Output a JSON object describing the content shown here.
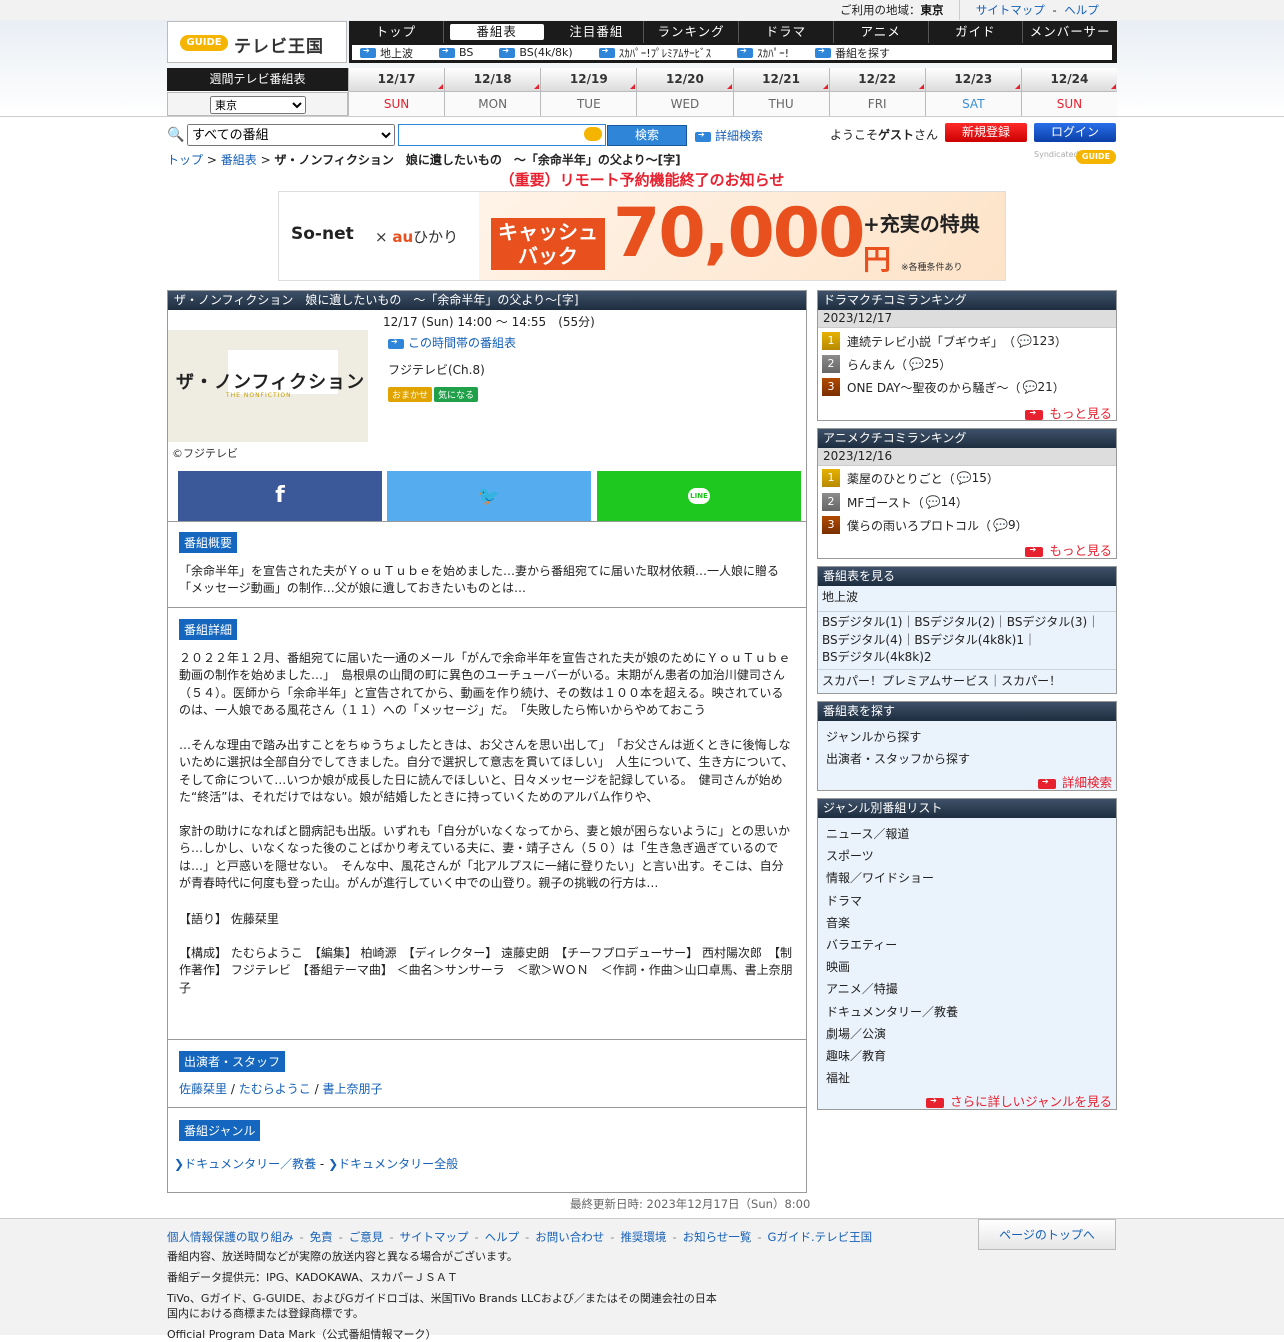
{
  "topbar": {
    "area_label": "ご利用の地域：",
    "area_value": "東京",
    "sitemap": "サイトマップ",
    "dash": "-",
    "help": "ヘルプ"
  },
  "logo": {
    "g": "GUIDE",
    "text": "テレビ王国"
  },
  "nav": [
    "トップ",
    "番組表",
    "注目番組",
    "ランキング",
    "ドラマ",
    "アニメ",
    "ガイド",
    "メンバーサービス"
  ],
  "subnav": [
    "地上波",
    "BS",
    "BS(4k/8k)",
    "ｽｶﾊﾟｰ!ﾌﾟﾚﾐｱﾑｻｰﾋﾞｽ",
    "ｽｶﾊﾟｰ!",
    "番組を探す"
  ],
  "week": {
    "label": "週間テレビ番組表",
    "area": "東京",
    "days": [
      {
        "date": "12/17",
        "wday": "SUN",
        "type": "sun"
      },
      {
        "date": "12/18",
        "wday": "MON",
        "type": "wd"
      },
      {
        "date": "12/19",
        "wday": "TUE",
        "type": "wd"
      },
      {
        "date": "12/20",
        "wday": "WED",
        "type": "wd"
      },
      {
        "date": "12/21",
        "wday": "THU",
        "type": "wd"
      },
      {
        "date": "12/22",
        "wday": "FRI",
        "type": "wd"
      },
      {
        "date": "12/23",
        "wday": "SAT",
        "type": "sat"
      },
      {
        "date": "12/24",
        "wday": "SUN",
        "type": "sun"
      }
    ]
  },
  "search": {
    "select": "すべての番組",
    "button": "検索",
    "advanced": "詳細検索"
  },
  "user": {
    "welcome_pre": "ようこそ",
    "guest": "ゲスト",
    "welcome_post": "さん",
    "signup": "新規登録",
    "login": "ログイン"
  },
  "breadcrumb": {
    "top": "トップ",
    "sep": ">",
    "schedule": "番組表",
    "current": "ザ・ノンフィクション　娘に遺したいもの　～「余命半年」の父より～[字]"
  },
  "syndicated": "Syndicated",
  "notice": "（重要）リモート予約機能終了のお知らせ",
  "banner": {
    "sonet": "So-net",
    "x": "×",
    "au": "au",
    "hikari": "ひかり",
    "cash1": "キャッシュ",
    "cash2": "バック",
    "amount": "70,000",
    "yen": "円",
    "plus": "+充実の特典",
    "cond": "※各種条件あり"
  },
  "program": {
    "title": "ザ・ノンフィクション　娘に遺したいもの　～「余命半年」の父より～[字]",
    "time": "12/17 (Sun) 14:00 ～ 14:55　(55分)",
    "time_link": "この時間帯の番組表",
    "channel": "フジテレビ(Ch.8)",
    "badges": [
      "おまかせ",
      "気になる"
    ],
    "thumb_title": "ザ・ノンフィクション",
    "thumb_sub": "THE NONFICTION",
    "copyright": "©フジテレビ",
    "share": {
      "facebook": "f",
      "twitter": "🐦",
      "line": "LINE"
    },
    "summary_head": "番組概要",
    "summary": "「余命半年」を宣告された夫がＹｏｕＴｕｂｅを始めました…妻から番組宛てに届いた取材依頼…一人娘に贈る「メッセージ動画」の制作…父が娘に遺しておきたいものとは…",
    "detail_head": "番組詳細",
    "detail_p1": "２０２２年１２月、番組宛てに届いた一通のメール「がんで余命半年を宣告された夫が娘のためにＹｏｕＴｕｂｅ動画の制作を始めました…」　島根県の山間の町に異色のユーチューバーがいる。末期がん患者の加治川健司さん（５４）。医師から「余命半年」と宣告されてから、動画を作り続け、その数は１００本を超える。映されているのは、一人娘である風花さん（１１）への「メッセージ」だ。　「失敗したら怖いからやめておこう",
    "detail_p2": "…そんな理由で踏み出すことをちゅうちょしたときは、お父さんを思い出して」　「お父さんは逝くときに後悔しないために選択は全部自分でしてきました。自分で選択して意志を貫いてほしい」　人生について、生き方について、そして命について…いつか娘が成長した日に読んでほしいと、日々メッセージを記録している。　健司さんが始めた“終活”は、それだけではない。娘が結婚したときに持っていくためのアルバム作りや、",
    "detail_p3": "家計の助けになればと闘病記も出版。いずれも「自分がいなくなってから、妻と娘が困らないように」との思いから…しかし、いなくなった後のことばかり考えている夫に、妻・靖子さん（５０）は「生き急ぎ過ぎているのでは…」と戸惑いを隠せない。　そんな中、風花さんが「北アルプスに一緒に登りたい」と言い出す。そこは、自分が青春時代に何度も登った山。がんが進行していく中での山登り。親子の挑戦の行方は…",
    "detail_p4": "【語り】 佐藤栞里",
    "detail_p5": "【構成】 たむらようこ　【編集】 柏崎源　【ディレクター】 遠藤史朗　【チーフプロデューサー】 西村陽次郎　【制作著作】 フジテレビ　【番組テーマ曲】 ＜曲名＞サンサーラ　＜歌＞ＷＯＮ　＜作詞・作曲＞山口卓馬、書上奈朋子",
    "cast_head": "出演者・スタッフ",
    "cast": [
      "佐藤栞里",
      "たむらようこ",
      "書上奈朋子"
    ],
    "cast_sep": "/",
    "genre_head": "番組ジャンル",
    "genres": [
      "ドキュメンタリー／教養",
      "ドキュメンタリー全般"
    ],
    "genre_sep": "-",
    "updated": "最終更新日時: 2023年12月17日（Sun）8:00"
  },
  "drama_rank": {
    "title": "ドラマクチコミランキング",
    "date": "2023/12/17",
    "items": [
      {
        "rank": "1",
        "title": "連続テレビ小説「ブギウギ」",
        "count": "123"
      },
      {
        "rank": "2",
        "title": "らんまん",
        "count": "25"
      },
      {
        "rank": "3",
        "title": "ONE DAY～聖夜のから騒ぎ～",
        "count": "21"
      }
    ],
    "more": "もっと見る"
  },
  "anime_rank": {
    "title": "アニメクチコミランキング",
    "date": "2023/12/16",
    "items": [
      {
        "rank": "1",
        "title": "薬屋のひとりごと",
        "count": "15"
      },
      {
        "rank": "2",
        "title": "MFゴースト",
        "count": "14"
      },
      {
        "rank": "3",
        "title": "僕らの雨いろプロトコル",
        "count": "9"
      }
    ],
    "more": "もっと見る"
  },
  "schedule_box": {
    "title": "番組表を見る",
    "terrestrial": "地上波",
    "bs_line1": "BSデジタル(1)｜BSデジタル(2)｜BSデジタル(3)｜",
    "bs_line2": "BSデジタル(4)｜BSデジタル(4k8k)1｜",
    "bs_line3": "BSデジタル(4k8k)2",
    "sky": "スカパー！プレミアムサービス｜スカパー！"
  },
  "find_box": {
    "title": "番組表を探す",
    "genre": "ジャンルから探す",
    "cast": "出演者・スタッフから探す",
    "adv": "詳細検索"
  },
  "genre_box": {
    "title": "ジャンル別番組リスト",
    "items": [
      "ニュース／報道",
      "スポーツ",
      "情報／ワイドショー",
      "ドラマ",
      "音楽",
      "バラエティー",
      "映画",
      "アニメ／特撮",
      "ドキュメンタリー／教養",
      "劇場／公演",
      "趣味／教育",
      "福祉"
    ],
    "more": "さらに詳しいジャンルを見る"
  },
  "footer": {
    "links": [
      "個人情報保護の取り組み",
      "免責",
      "ご意見",
      "サイトマップ",
      "ヘルプ",
      "お問い合わせ",
      "推奨環境",
      "お知らせ一覧",
      "Gガイド.テレビ王国"
    ],
    "link_sep": "-",
    "pagetop": "ページのトップへ",
    "l1": "番組内容、放送時間などが実際の放送内容と異なる場合がございます。",
    "l2": "番組データ提供元：IPG、KADOKAWA、スカパーＪＳＡＴ",
    "l3": "TiVo、Gガイド、G-GUIDE、およびGガイドロゴは、米国TiVo Brands LLCおよび／またはその関連会社の日本",
    "l4": "国内における商標または登録商標です。",
    "l5": "Official Program Data Mark（公式番組情報マーク）"
  }
}
